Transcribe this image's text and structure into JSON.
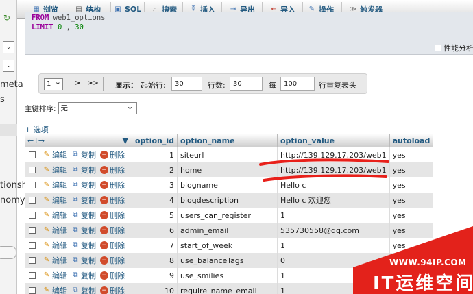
{
  "leftnav": {
    "fragments": [
      "meta",
      "s",
      "tionsh",
      "nomy"
    ]
  },
  "tabs": [
    {
      "label": "浏览",
      "icon": "browse-icon"
    },
    {
      "label": "结构",
      "icon": "structure-icon"
    },
    {
      "label": "SQL",
      "icon": "sql-icon"
    },
    {
      "label": "搜索",
      "icon": "search-icon"
    },
    {
      "label": "插入",
      "icon": "insert-icon"
    },
    {
      "label": "导出",
      "icon": "export-icon"
    },
    {
      "label": "导入",
      "icon": "import-icon"
    },
    {
      "label": "操作",
      "icon": "wrench-icon"
    },
    {
      "label": "触发器",
      "icon": "trigger-icon"
    }
  ],
  "sql": {
    "from_kw": "FROM",
    "table": "web1_options",
    "limit_kw": "LIMIT",
    "offset": "0",
    "sep": ",",
    "count": "30"
  },
  "profiling_label": "性能分析",
  "navigation": {
    "page": "1",
    "next": ">",
    "last": ">>",
    "show_label": "显示：",
    "start_label": "起始行:",
    "start_value": "30",
    "rows_label": "行数:",
    "rows_value": "30",
    "every_label": "每",
    "every_value": "100",
    "repeat_label": "行重复表头"
  },
  "sort": {
    "label": "主键排序:",
    "value": "无"
  },
  "options_link": "+ 选项",
  "table": {
    "arrow_left": "←T→",
    "arrow_sort": "▼",
    "headers": [
      "option_id",
      "option_name",
      "option_value",
      "autoload"
    ],
    "actions": {
      "edit": "编辑",
      "copy": "复制",
      "delete": "删除"
    },
    "rows": [
      {
        "id": "1",
        "name": "siteurl",
        "value": "http://139.129.17.203/web1",
        "autoload": "yes"
      },
      {
        "id": "2",
        "name": "home",
        "value": "http://139.129.17.203/web1",
        "autoload": "yes"
      },
      {
        "id": "3",
        "name": "blogname",
        "value": "Hello c",
        "autoload": "yes"
      },
      {
        "id": "4",
        "name": "blogdescription",
        "value": "Hello c 欢迎您",
        "autoload": "yes"
      },
      {
        "id": "5",
        "name": "users_can_register",
        "value": "1",
        "autoload": "yes"
      },
      {
        "id": "6",
        "name": "admin_email",
        "value": "535730558@qq.com",
        "autoload": "yes"
      },
      {
        "id": "7",
        "name": "start_of_week",
        "value": "1",
        "autoload": "yes"
      },
      {
        "id": "8",
        "name": "use_balanceTags",
        "value": "0",
        "autoload": "yes"
      },
      {
        "id": "9",
        "name": "use_smilies",
        "value": "1",
        "autoload": "yes"
      },
      {
        "id": "10",
        "name": "require_name_email",
        "value": "1",
        "autoload": "yes"
      }
    ]
  },
  "watermark": {
    "url": "WWW.94IP.COM",
    "name": "IT运维空间"
  },
  "colors": {
    "link": "#235a81",
    "marker": "#e8201a",
    "watermark": "#e3221b"
  }
}
